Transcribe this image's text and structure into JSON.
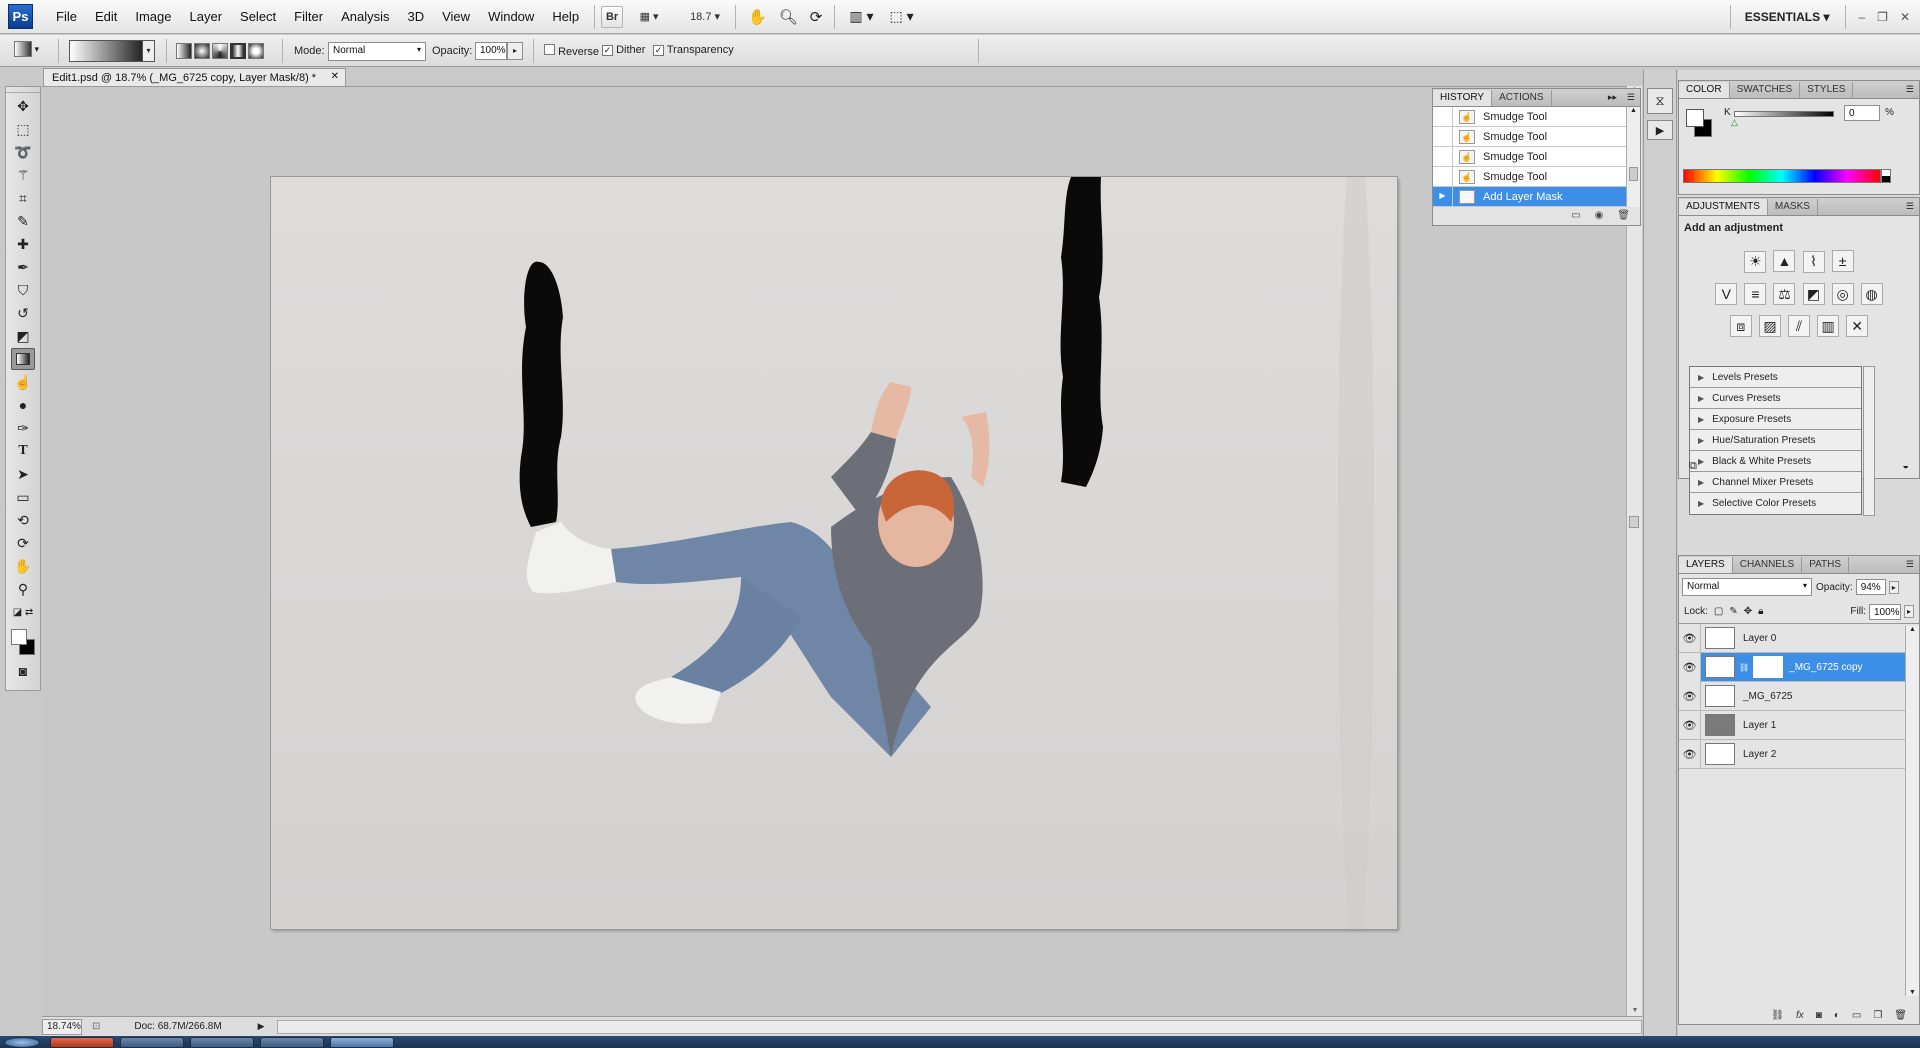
{
  "menubar": {
    "logo": "Ps",
    "menus": [
      "File",
      "Edit",
      "Image",
      "Layer",
      "Select",
      "Filter",
      "Analysis",
      "3D",
      "View",
      "Window",
      "Help"
    ],
    "bridge_label": "Br",
    "zoom_value": "18.7",
    "workspace": "ESSENTIALS"
  },
  "options": {
    "mode_label": "Mode:",
    "mode_value": "Normal",
    "opacity_label": "Opacity:",
    "opacity_value": "100%",
    "reverse_label": "Reverse",
    "reverse_checked": false,
    "dither_label": "Dither",
    "dither_checked": true,
    "transparency_label": "Transparency",
    "transparency_checked": true
  },
  "document": {
    "tab_title": "Edit1.psd @ 18.7% (_MG_6725 copy, Layer Mask/8) *"
  },
  "status": {
    "zoom": "18.74%",
    "doc_size": "Doc: 68.7M/266.8M"
  },
  "history": {
    "tabs": [
      "HISTORY",
      "ACTIONS"
    ],
    "items": [
      "Smudge Tool",
      "Smudge Tool",
      "Smudge Tool",
      "Smudge Tool",
      "Add Layer Mask"
    ],
    "selected_index": 4
  },
  "color_panel": {
    "tabs": [
      "COLOR",
      "SWATCHES",
      "STYLES"
    ],
    "channel_label": "K",
    "channel_value": "0",
    "unit": "%"
  },
  "adjustments": {
    "tabs": [
      "ADJUSTMENTS",
      "MASKS"
    ],
    "heading": "Add an adjustment",
    "presets": [
      "Levels Presets",
      "Curves Presets",
      "Exposure Presets",
      "Hue/Saturation Presets",
      "Black & White Presets",
      "Channel Mixer Presets",
      "Selective Color Presets"
    ]
  },
  "layers": {
    "tabs": [
      "LAYERS",
      "CHANNELS",
      "PATHS"
    ],
    "blend_mode": "Normal",
    "opacity_label": "Opacity:",
    "opacity_value": "94%",
    "lock_label": "Lock:",
    "fill_label": "Fill:",
    "fill_value": "100%",
    "items": [
      {
        "name": "Layer 0"
      },
      {
        "name": "_MG_6725 copy"
      },
      {
        "name": "_MG_6725"
      },
      {
        "name": "Layer 1"
      },
      {
        "name": "Layer 2"
      }
    ],
    "selected_index": 1
  },
  "colors": {
    "accent": "#3d8ee6",
    "canvas_bg": "#d8d6d5",
    "workspace_bg": "#c8c8c8"
  }
}
